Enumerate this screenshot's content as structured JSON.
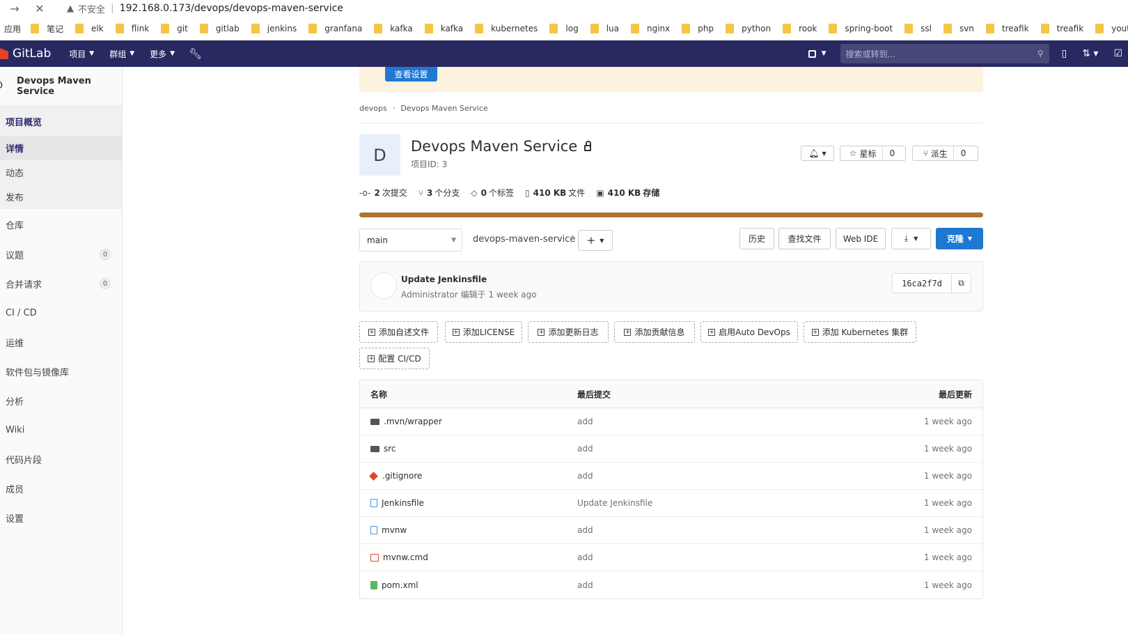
{
  "browser": {
    "insecure_label": "不安全",
    "url": "192.168.0.173/devops/devops-maven-service",
    "apps_label": "应用",
    "bookmarks": [
      "笔记",
      "elk",
      "flink",
      "git",
      "gitlab",
      "jenkins",
      "granfana",
      "kafka",
      "kafka",
      "kubernetes",
      "log",
      "lua",
      "nginx",
      "php",
      "python",
      "rook",
      "spring-boot",
      "ssl",
      "svn",
      "treafik",
      "treafik",
      "youtube"
    ]
  },
  "navbar": {
    "brand": "GitLab",
    "items": [
      "项目",
      "群组",
      "更多"
    ],
    "search_placeholder": "搜索或转到..."
  },
  "sidebar": {
    "project_name": "Devops Maven Service",
    "avatar_fragment": "D",
    "overview": "项目概览",
    "overview_items": [
      "详情",
      "动态",
      "发布"
    ],
    "items": [
      {
        "label": "仓库"
      },
      {
        "label": "议题",
        "badge": "0"
      },
      {
        "label": "合并请求",
        "badge": "0"
      },
      {
        "label": "CI / CD"
      },
      {
        "label": "运维"
      },
      {
        "label": "软件包与镜像库"
      },
      {
        "label": "分析"
      },
      {
        "label": "Wiki"
      },
      {
        "label": "代码片段"
      },
      {
        "label": "成员"
      },
      {
        "label": "设置"
      }
    ]
  },
  "banner": {
    "button": "查看设置"
  },
  "breadcrumb": [
    "devops",
    "Devops Maven Service"
  ],
  "project": {
    "avatar_letter": "D",
    "title": "Devops Maven Service",
    "id_label": "项目ID: 3",
    "star_label": "星标",
    "star_count": "0",
    "fork_label": "派生",
    "fork_count": "0"
  },
  "stats": [
    {
      "num": "2",
      "label": "次提交"
    },
    {
      "num": "3",
      "label": "个分支"
    },
    {
      "num": "0",
      "label": "个标签"
    },
    {
      "num": "410 KB",
      "label": "文件"
    },
    {
      "num": "410 KB",
      "label": "存储"
    }
  ],
  "repo": {
    "branch": "main",
    "path": "devops-maven-service",
    "slash": "/",
    "history": "历史",
    "find_file": "查找文件",
    "web_ide": "Web IDE",
    "clone": "克隆"
  },
  "commit": {
    "title": "Update Jenkinsfile",
    "author": "Administrator",
    "meta_rest": " 编辑于 1 week ago",
    "sha": "16ca2f7d"
  },
  "quick_actions": [
    "添加自述文件",
    "添加LICENSE",
    "添加更新日志",
    "添加贡献信息",
    "启用Auto DevOps",
    "添加 Kubernetes 集群",
    "配置 CI/CD"
  ],
  "table": {
    "headers": [
      "名称",
      "最后提交",
      "最后更新"
    ],
    "rows": [
      {
        "name": ".mvn/wrapper",
        "icon": "folder-icon",
        "commit": "add",
        "updated": "1 week ago"
      },
      {
        "name": "src",
        "icon": "folder-icon",
        "commit": "add",
        "updated": "1 week ago"
      },
      {
        "name": ".gitignore",
        "icon": "git-icon",
        "commit": "add",
        "updated": "1 week ago"
      },
      {
        "name": "Jenkinsfile",
        "icon": "file-icon",
        "commit": "Update Jenkinsfile",
        "updated": "1 week ago"
      },
      {
        "name": "mvnw",
        "icon": "file-icon",
        "commit": "add",
        "updated": "1 week ago"
      },
      {
        "name": "mvnw.cmd",
        "icon": "terminal-file-icon",
        "commit": "add",
        "updated": "1 week ago"
      },
      {
        "name": "pom.xml",
        "icon": "xml-file-icon",
        "commit": "add",
        "updated": "1 week ago"
      }
    ]
  },
  "colors": {
    "navbar": "#292961",
    "accent": "#1f78d1",
    "lang_bar": "#b07430",
    "banner": "#fdf1e0"
  }
}
